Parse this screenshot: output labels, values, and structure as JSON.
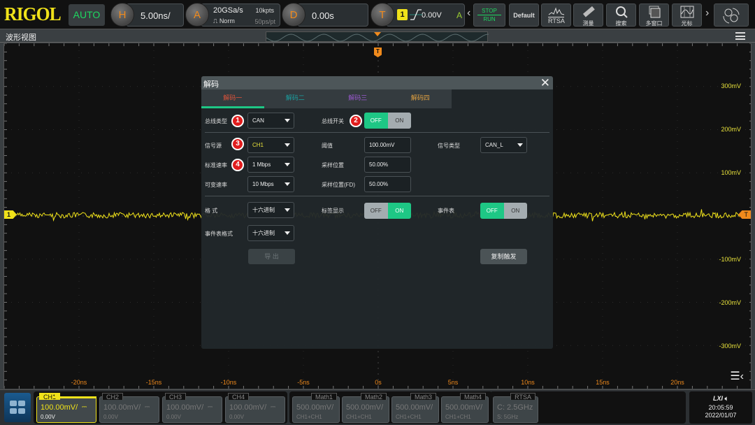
{
  "topbar": {
    "brand": "RIGOL",
    "run_mode": "AUTO",
    "horizontal": {
      "icon": "H",
      "timebase": "5.00ns/"
    },
    "acquire": {
      "icon": "A",
      "sample_rate": "20GSa/s",
      "mode": "Norm",
      "memory_depth": "10kpts",
      "resolution": "50ps/pt"
    },
    "delay": {
      "icon": "D",
      "value": "0.00s"
    },
    "trigger": {
      "icon": "T",
      "source": "1",
      "level": "0.00V",
      "sweep": "A"
    },
    "buttons": [
      {
        "name": "stop-run",
        "label_top": "STOP",
        "label_bottom": "RUN"
      },
      {
        "name": "default",
        "label": "Default"
      },
      {
        "name": "rtsa",
        "label": "RTSA"
      },
      {
        "name": "measure",
        "label": "测量"
      },
      {
        "name": "search",
        "label": "搜索"
      },
      {
        "name": "multi-window",
        "label": "多窗口"
      },
      {
        "name": "cursor",
        "label": "光标"
      }
    ]
  },
  "waveform_view": {
    "title": "波形视图",
    "trigger_marker": "T",
    "channel_marker": "1",
    "y_labels": [
      "300mV",
      "200mV",
      "100mV",
      "-100mV",
      "-200mV",
      "-300mV"
    ],
    "x_labels": [
      "-20ns",
      "-15ns",
      "-10ns",
      "-5ns",
      "0s",
      "5ns",
      "10ns",
      "15ns",
      "20ns"
    ]
  },
  "dialog": {
    "title": "解码",
    "tabs": [
      {
        "label": "解码一",
        "color": "#e0533a",
        "active": true
      },
      {
        "label": "解码二",
        "color": "#1a9fa0",
        "active": false
      },
      {
        "label": "解码三",
        "color": "#9b59d0",
        "active": false
      },
      {
        "label": "解码四",
        "color": "#e0a040",
        "active": false
      }
    ],
    "bus_type": {
      "label": "总线类型",
      "value": "CAN",
      "badge": "1"
    },
    "bus_switch": {
      "label": "总线开关",
      "off": "OFF",
      "on": "ON",
      "state": "OFF",
      "badge": "2"
    },
    "source": {
      "label": "信号源",
      "value": "CH1",
      "badge": "3"
    },
    "threshold": {
      "label": "阈值",
      "value": "100.00mV"
    },
    "signal_type": {
      "label": "信号类型",
      "value": "CAN_L"
    },
    "std_rate": {
      "label": "标准速率",
      "value": "1 Mbps",
      "badge": "4"
    },
    "sample_point": {
      "label": "采样位置",
      "value": "50.00%"
    },
    "var_rate": {
      "label": "可变速率",
      "value": "10 Mbps"
    },
    "sample_point_fd": {
      "label": "采样位置(FD)",
      "value": "50.00%"
    },
    "format": {
      "label": "格 式",
      "value": "十六进制"
    },
    "label_display": {
      "label": "标签显示",
      "off": "OFF",
      "on": "ON",
      "state": "ON"
    },
    "event_table": {
      "label": "事件表",
      "off": "OFF",
      "on": "ON",
      "state": "OFF"
    },
    "event_format": {
      "label": "事件表格式",
      "value": "十六进制"
    },
    "export_label": "导 出",
    "copy_trigger_label": "复制触发"
  },
  "bottombar": {
    "channels": [
      {
        "name": "CH1",
        "scale": "100.00mV/",
        "offset": "0.00V",
        "active": true
      },
      {
        "name": "CH2",
        "scale": "100.00mV/",
        "offset": "0.00V",
        "active": false
      },
      {
        "name": "CH3",
        "scale": "100.00mV/",
        "offset": "0.00V",
        "active": false
      },
      {
        "name": "CH4",
        "scale": "100.00mV/",
        "offset": "0.00V",
        "active": false
      }
    ],
    "maths": [
      {
        "name": "Math1",
        "scale": "500.00mV/",
        "expr": "CH1+CH1"
      },
      {
        "name": "Math2",
        "scale": "500.00mV/",
        "expr": "CH1+CH1"
      },
      {
        "name": "Math3",
        "scale": "500.00mV/",
        "expr": "CH1+CH1"
      },
      {
        "name": "Math4",
        "scale": "500.00mV/",
        "expr": "CH1+CH1"
      }
    ],
    "rtsa": {
      "name": "RTSA",
      "center": "C: 2.5GHz",
      "span": "S: 5GHz"
    },
    "status": {
      "lxi": "LXI",
      "time": "20:05:59",
      "date": "2022/01/07"
    }
  },
  "colors": {
    "ch1": "#f0e21a",
    "trigger": "#f08a1c",
    "accent_green": "#1ec785"
  }
}
